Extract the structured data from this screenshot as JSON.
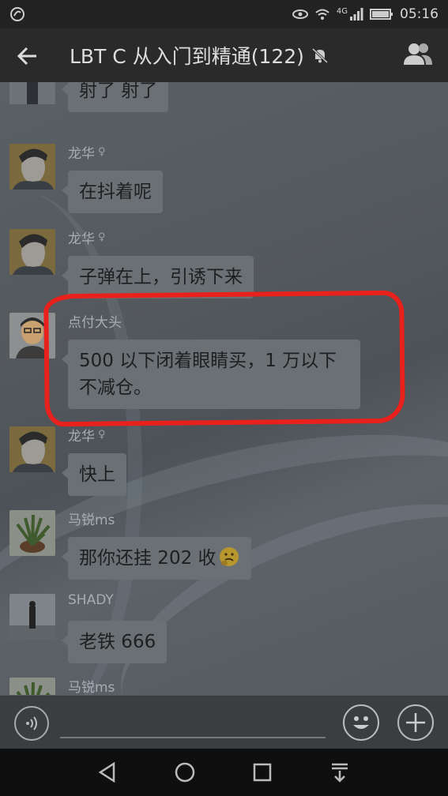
{
  "status_bar": {
    "network": "4G",
    "time": "05:16"
  },
  "header": {
    "title": "LBT C 从入门到精通(122)",
    "icons": [
      "back-arrow-icon",
      "mute-bell-icon",
      "group-members-icon"
    ]
  },
  "messages": [
    {
      "sender": "",
      "text": "射了 射了"
    },
    {
      "sender": "龙华",
      "text": "在抖着呢"
    },
    {
      "sender": "龙华",
      "text": "子弹在上，引诱下来"
    },
    {
      "sender": "点付大头",
      "text": "500 以下闭着眼睛买，1 万以下不减仓。"
    },
    {
      "sender": "龙华",
      "text": "快上"
    },
    {
      "sender": "马锐ms",
      "text": "那你还挂 202 收"
    },
    {
      "sender": "SHADY",
      "text": "老铁 666"
    },
    {
      "sender": "马锐ms",
      "text": ""
    }
  ],
  "input_bar": {
    "icons": [
      "voice-icon",
      "emoji-icon",
      "plus-icon"
    ]
  },
  "nav_bar": {
    "icons": [
      "back-triangle-icon",
      "home-circle-icon",
      "recents-square-icon",
      "notification-pull-icon"
    ]
  },
  "colors": {
    "highlight_ring": "#e8211c",
    "bubble": "#6b7075",
    "header": "#2a2a2a"
  }
}
